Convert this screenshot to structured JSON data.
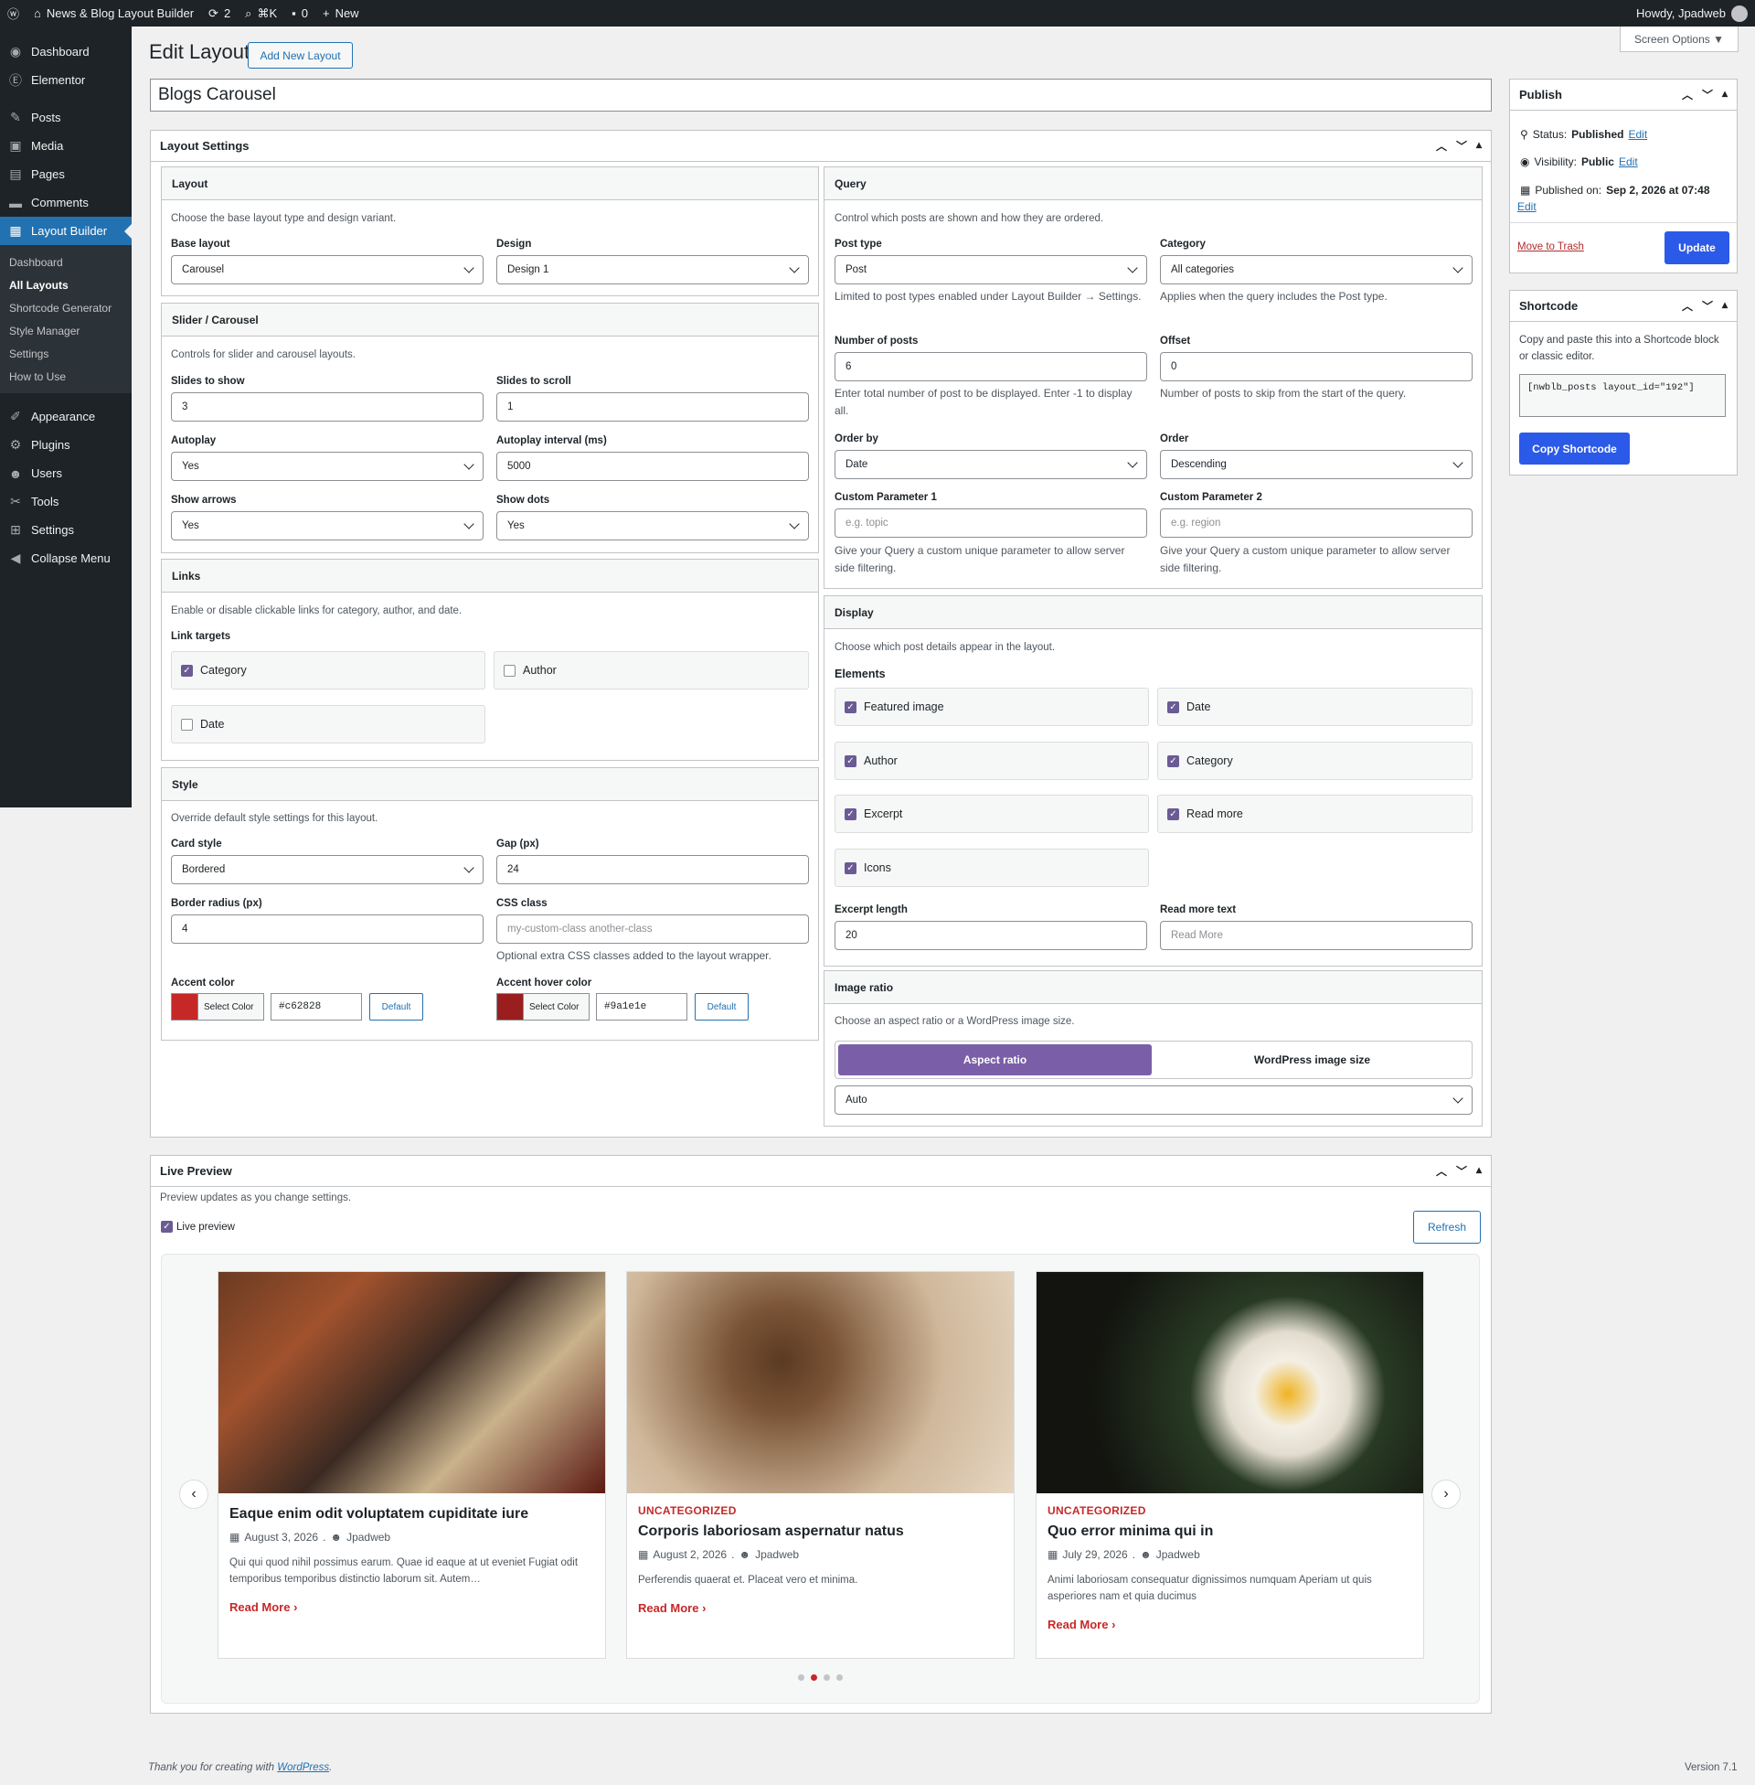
{
  "adminbar": {
    "site_name": "News & Blog Layout Builder",
    "updates_count": "2",
    "shortcut": "⌘K",
    "comments_count": "0",
    "new_label": "New",
    "howdy": "Howdy, Jpadweb"
  },
  "sidebar": {
    "items": [
      {
        "label": "Dashboard",
        "icon": "dashboard-icon"
      },
      {
        "label": "Elementor",
        "icon": "elementor-icon"
      },
      {
        "label": "Posts",
        "icon": "pin-icon"
      },
      {
        "label": "Media",
        "icon": "media-icon"
      },
      {
        "label": "Pages",
        "icon": "pages-icon"
      },
      {
        "label": "Comments",
        "icon": "comments-icon"
      },
      {
        "label": "Layout Builder",
        "icon": "grid-icon"
      },
      {
        "label": "Appearance",
        "icon": "brush-icon"
      },
      {
        "label": "Plugins",
        "icon": "plugin-icon"
      },
      {
        "label": "Users",
        "icon": "user-icon"
      },
      {
        "label": "Tools",
        "icon": "wrench-icon"
      },
      {
        "label": "Settings",
        "icon": "settings-icon"
      },
      {
        "label": "Collapse Menu",
        "icon": "collapse-icon"
      }
    ],
    "submenu": [
      "Dashboard",
      "All Layouts",
      "Shortcode Generator",
      "Style Manager",
      "Settings",
      "How to Use"
    ]
  },
  "header": {
    "title": "Edit Layout",
    "add_new": "Add New Layout",
    "screen_options": "Screen Options ▼",
    "layout_title": "Blogs Carousel"
  },
  "layout_settings": {
    "title": "Layout Settings",
    "layout": {
      "title": "Layout",
      "desc": "Choose the base layout type and design variant.",
      "base_label": "Base layout",
      "base_value": "Carousel",
      "design_label": "Design",
      "design_value": "Design 1"
    },
    "slider": {
      "title": "Slider / Carousel",
      "desc": "Controls for slider and carousel layouts.",
      "show_label": "Slides to show",
      "show_value": "3",
      "scroll_label": "Slides to scroll",
      "scroll_value": "1",
      "autoplay_label": "Autoplay",
      "autoplay_value": "Yes",
      "interval_label": "Autoplay interval (ms)",
      "interval_value": "5000",
      "arrows_label": "Show arrows",
      "arrows_value": "Yes",
      "dots_label": "Show dots",
      "dots_value": "Yes"
    },
    "links": {
      "title": "Links",
      "desc": "Enable or disable clickable links for category, author, and date.",
      "targets_label": "Link targets",
      "category": "Category",
      "author": "Author",
      "date": "Date"
    },
    "style": {
      "title": "Style",
      "desc": "Override default style settings for this layout.",
      "card_label": "Card style",
      "card_value": "Bordered",
      "gap_label": "Gap (px)",
      "gap_value": "24",
      "radius_label": "Border radius (px)",
      "radius_value": "4",
      "css_label": "CSS class",
      "css_placeholder": "my-custom-class another-class",
      "css_help": "Optional extra CSS classes added to the layout wrapper.",
      "accent_label": "Accent color",
      "accent_hex": "#c62828",
      "hover_label": "Accent hover color",
      "hover_hex": "#9a1e1e",
      "select_color": "Select Color",
      "default_btn": "Default"
    },
    "query": {
      "title": "Query",
      "desc": "Control which posts are shown and how they are ordered.",
      "posttype_label": "Post type",
      "posttype_value": "Post",
      "posttype_help": "Limited to post types enabled under Layout Builder → Settings.",
      "category_label": "Category",
      "category_value": "All categories",
      "category_help": "Applies when the query includes the Post type.",
      "num_label": "Number of posts",
      "num_value": "6",
      "num_help": "Enter total number of post to be displayed. Enter -1 to display all.",
      "offset_label": "Offset",
      "offset_value": "0",
      "offset_help": "Number of posts to skip from the start of the query.",
      "orderby_label": "Order by",
      "orderby_value": "Date",
      "order_label": "Order",
      "order_value": "Descending",
      "cp1_label": "Custom Parameter 1",
      "cp1_placeholder": "e.g. topic",
      "cp2_label": "Custom Parameter 2",
      "cp2_placeholder": "e.g. region",
      "cp_help": "Give your Query a custom unique parameter to allow server side filtering."
    },
    "display": {
      "title": "Display",
      "desc": "Choose which post details appear in the layout.",
      "elements_label": "Elements",
      "featured": "Featured image",
      "date": "Date",
      "author": "Author",
      "category": "Category",
      "excerpt": "Excerpt",
      "readmore": "Read more",
      "icons": "Icons",
      "excerpt_len_label": "Excerpt length",
      "excerpt_len_value": "20",
      "rm_text_label": "Read more text",
      "rm_text_placeholder": "Read More"
    },
    "ratio": {
      "title": "Image ratio",
      "desc": "Choose an aspect ratio or a WordPress image size.",
      "aspect": "Aspect ratio",
      "wpsize": "WordPress image size",
      "value": "Auto"
    }
  },
  "publish": {
    "title": "Publish",
    "status_label": "Status:",
    "status_value": "Published",
    "visibility_label": "Visibility:",
    "visibility_value": "Public",
    "published_label": "Published on:",
    "published_value": "Sep 2, 2026 at 07:48",
    "edit": "Edit",
    "trash": "Move to Trash",
    "update": "Update"
  },
  "shortcode": {
    "title": "Shortcode",
    "desc": "Copy and paste this into a Shortcode block or classic editor.",
    "code": "[nwblb_posts layout_id=\"192\"]",
    "copy": "Copy Shortcode"
  },
  "preview": {
    "title": "Live Preview",
    "desc": "Preview updates as you change settings.",
    "live_label": "Live preview",
    "refresh": "Refresh",
    "cards": [
      {
        "category": "",
        "title": "Eaque enim odit voluptatem cupiditate iure",
        "date": "August 3, 2026",
        "author": "Jpadweb",
        "excerpt": "Qui qui quod nihil possimus earum. Quae id eaque at ut eveniet Fugiat odit temporibus temporibus distinctio laborum sit. Autem…",
        "readmore": "Read More"
      },
      {
        "category": "UNCATEGORIZED",
        "title": "Corporis laboriosam aspernatur natus",
        "date": "August 2, 2026",
        "author": "Jpadweb",
        "excerpt": "Perferendis quaerat et. Placeat vero et minima.",
        "readmore": "Read More"
      },
      {
        "category": "UNCATEGORIZED",
        "title": "Quo error minima qui in",
        "date": "July 29, 2026",
        "author": "Jpadweb",
        "excerpt": "Animi laboriosam consequatur dignissimos numquam Aperiam ut quis asperiores nam et quia ducimus",
        "readmore": "Read More"
      }
    ]
  },
  "footer": {
    "thanks": "Thank you for creating with",
    "wp_link": "WordPress",
    "period": ".",
    "version": "Version 7.1"
  },
  "colors": {
    "accent": "#c62828",
    "hover": "#9a1e1e",
    "primary": "#2b59e8",
    "purple": "#6b5b95"
  }
}
